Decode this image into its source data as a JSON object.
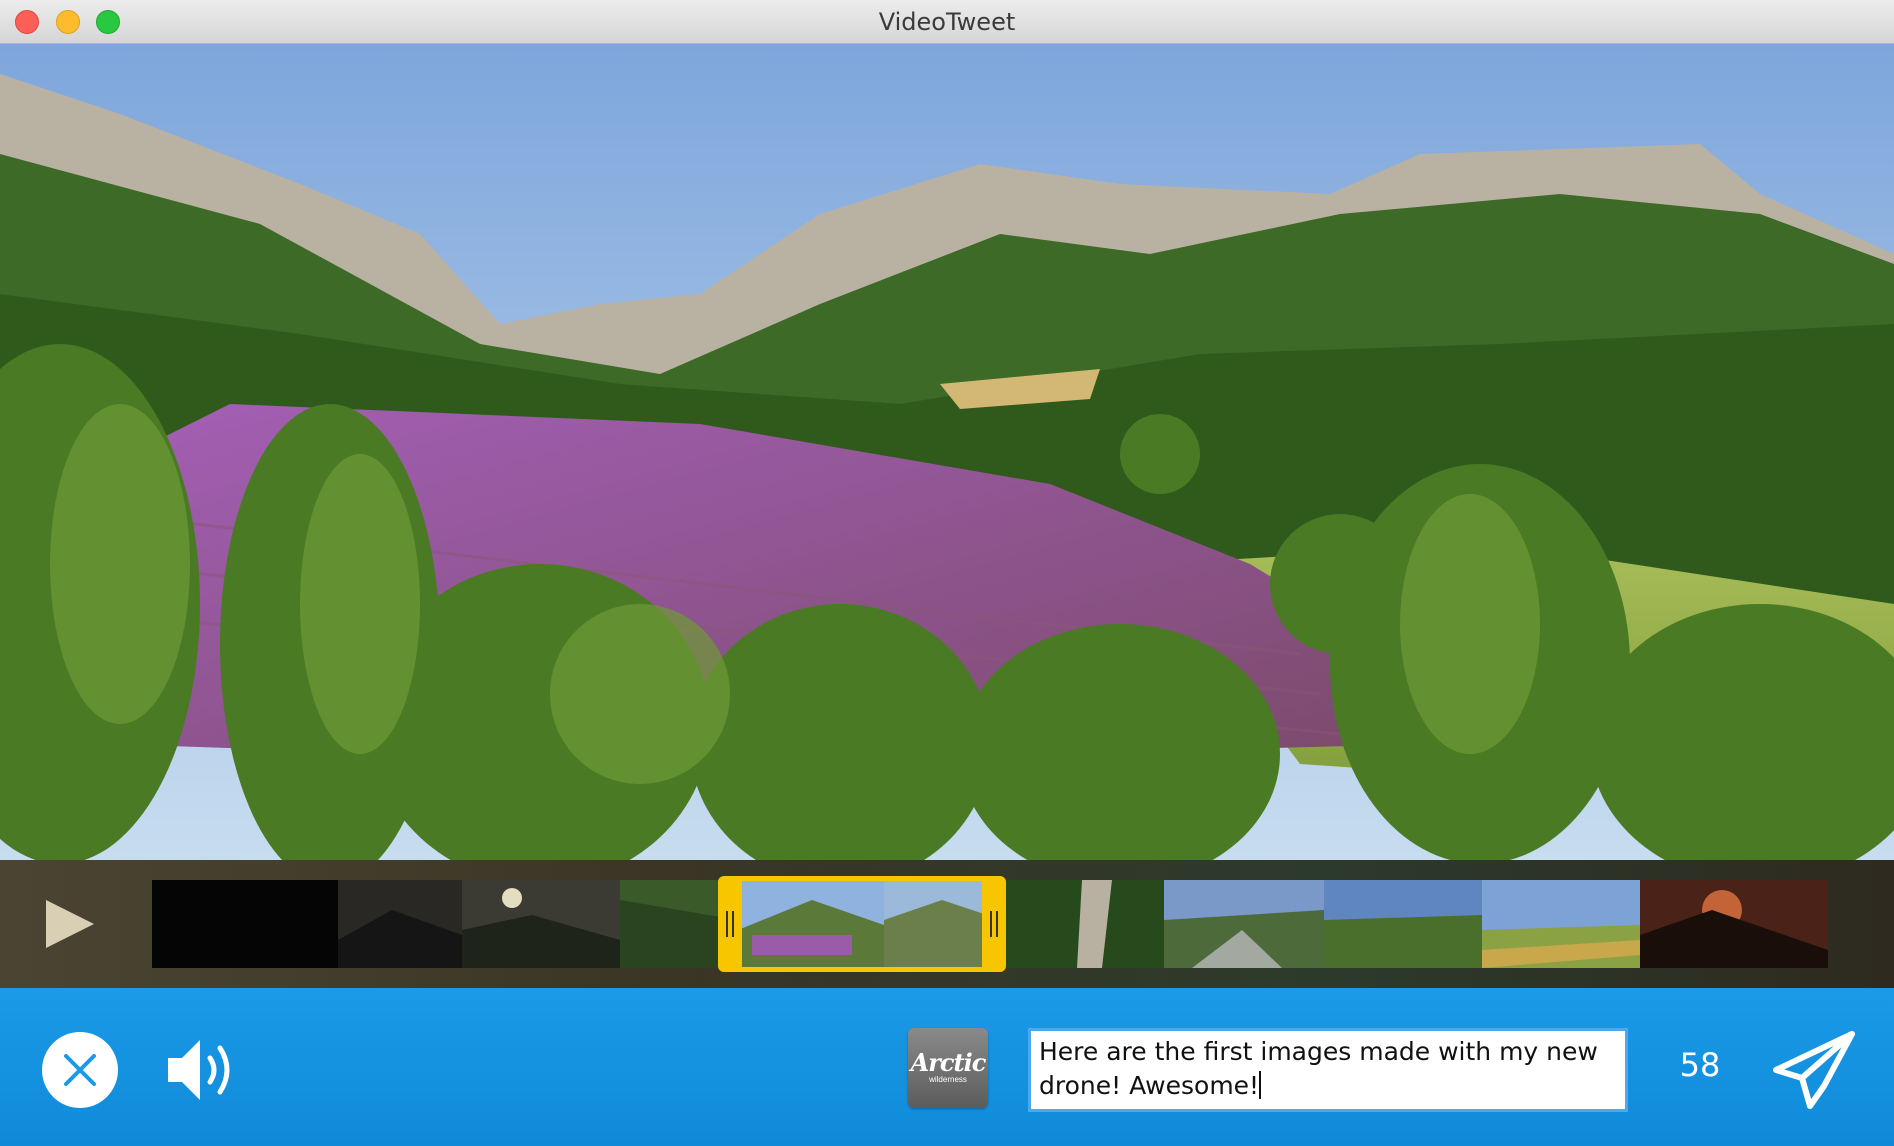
{
  "window": {
    "title": "VideoTweet"
  },
  "video": {
    "description_icon": "video-frame"
  },
  "timeline": {
    "play_icon": "play-icon",
    "frame_count": 11,
    "selection_color": "#f7c600"
  },
  "composer": {
    "cancel_icon": "close-icon",
    "volume_icon": "speaker-icon",
    "logo": {
      "main": "Arctic",
      "sub": "wilderness"
    },
    "tweet_text": "Here are the first images made with my new drone! Awesome!",
    "char_count": "58",
    "send_icon": "paper-plane-icon",
    "accent_color": "#1a9ae8"
  }
}
